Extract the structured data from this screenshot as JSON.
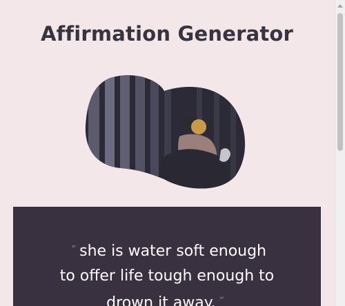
{
  "page": {
    "title": "Affirmation Generator"
  },
  "affirmation": {
    "open_quote": "“",
    "close_quote": "”",
    "lines": [
      "she is water soft enough",
      "to offer life tough enough to",
      "drown it away."
    ]
  },
  "image": {
    "description_icon": "portrait-image"
  },
  "colors": {
    "background": "#f3e7ea",
    "card": "#3a3140",
    "title": "#35343f",
    "quote_text": "#ffffff"
  }
}
